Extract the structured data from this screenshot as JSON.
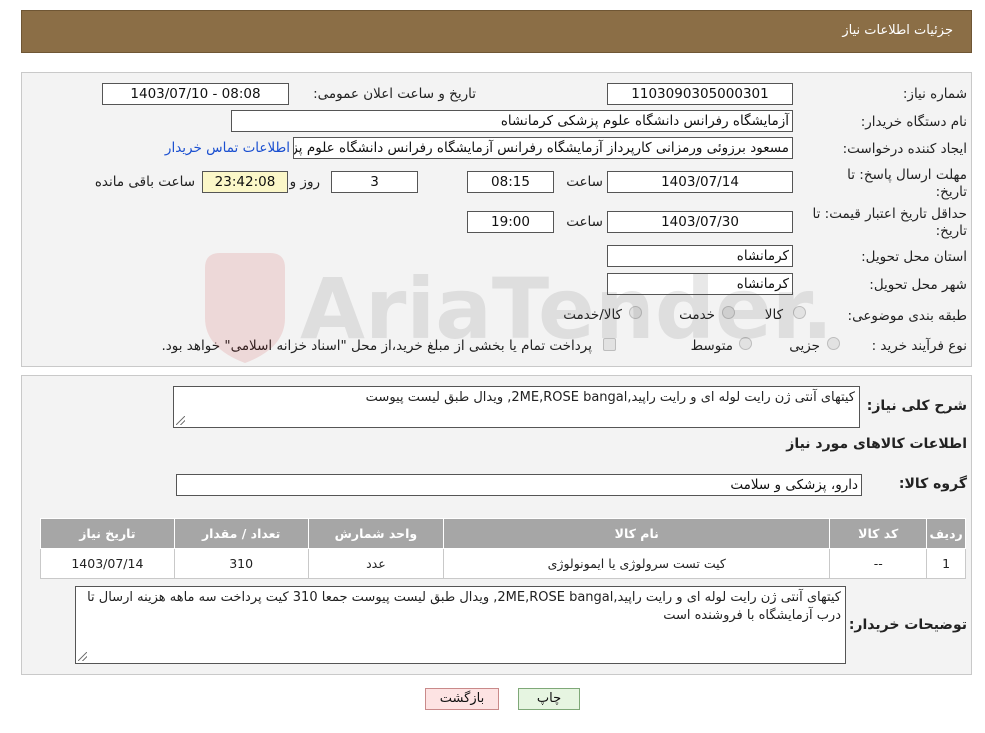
{
  "header": {
    "title": "جزئیات اطلاعات نیاز"
  },
  "labels": {
    "need_number": "شماره نیاز:",
    "announce_datetime": "تاریخ و ساعت اعلان عمومی:",
    "buyer_org": "نام دستگاه خریدار:",
    "requester": "ایجاد کننده درخواست:",
    "reply_deadline": "مهلت ارسال پاسخ: تا تاریخ:",
    "time": "ساعت",
    "day_and": "روز و",
    "hours_left": "ساعت باقی مانده",
    "min_price_validity": "حداقل تاریخ اعتبار قیمت: تا تاریخ:",
    "delivery_province": "استان محل تحویل:",
    "delivery_city": "شهر محل تحویل:",
    "category": "طبقه بندی موضوعی:",
    "purchase_type": "نوع فرآیند خرید :",
    "description": "شرح کلی نیاز:",
    "goods_info": "اطلاعات کالاهای مورد نیاز",
    "goods_group": "گروه کالا:",
    "buyer_notes": "توضیحات خریدار:"
  },
  "values": {
    "need_number": "1103090305000301",
    "announce_datetime": "1403/07/10 - 08:08",
    "buyer_org": "آزمایشگاه رفرانس دانشگاه علوم پزشکی کرمانشاه",
    "requester": "مسعود برزوئی ورمزانی کارپرداز آزمایشگاه رفرانس آزمایشگاه رفرانس دانشگاه علوم پزشکی کرمانشاه",
    "buyer_contact_link": "اطلاعات تماس خریدار",
    "reply_date": "1403/07/14",
    "reply_time": "08:15",
    "days_left": "3",
    "time_left": "23:42:08",
    "validity_date": "1403/07/30",
    "validity_time": "19:00",
    "province": "کرمانشاه",
    "city": "کرمانشاه",
    "category_options": [
      "کالا",
      "خدمت",
      "کالا/خدمت"
    ],
    "purchase_options": [
      "جزیی",
      "متوسط"
    ],
    "purchase_note": "پرداخت تمام یا بخشی از مبلغ خرید،از محل \"اسناد خزانه اسلامی\" خواهد بود.",
    "description": "کیتهای آنتی ژن رایت لوله ای و رایت راپید,2ME,ROSE bangal, ویدال طبق لیست پیوست",
    "goods_group": "دارو، پزشکی و سلامت",
    "buyer_notes": "کیتهای آنتی ژن رایت لوله ای و رایت راپید,2ME,ROSE bangal, ویدال طبق لیست پیوست جمعا  310 کیت پرداخت سه ماهه هزینه ارسال تا درب آزمایشگاه با فروشنده است"
  },
  "table": {
    "headers": [
      "ردیف",
      "کد کالا",
      "نام کالا",
      "واحد شمارش",
      "تعداد / مقدار",
      "تاریخ نیاز"
    ],
    "rows": [
      [
        "1",
        "--",
        "کیت تست سرولوژی یا ایمونولوژی",
        "عدد",
        "310",
        "1403/07/14"
      ]
    ]
  },
  "buttons": {
    "print": "چاپ",
    "back": "بازگشت"
  },
  "watermark": {
    "text": "AriaTender.neT"
  },
  "colors": {
    "header_bg": "#8b6e46",
    "link": "#1a4fd0",
    "back_button_bg": "#fde3e3",
    "print_button_bg": "#e6f5e1"
  }
}
